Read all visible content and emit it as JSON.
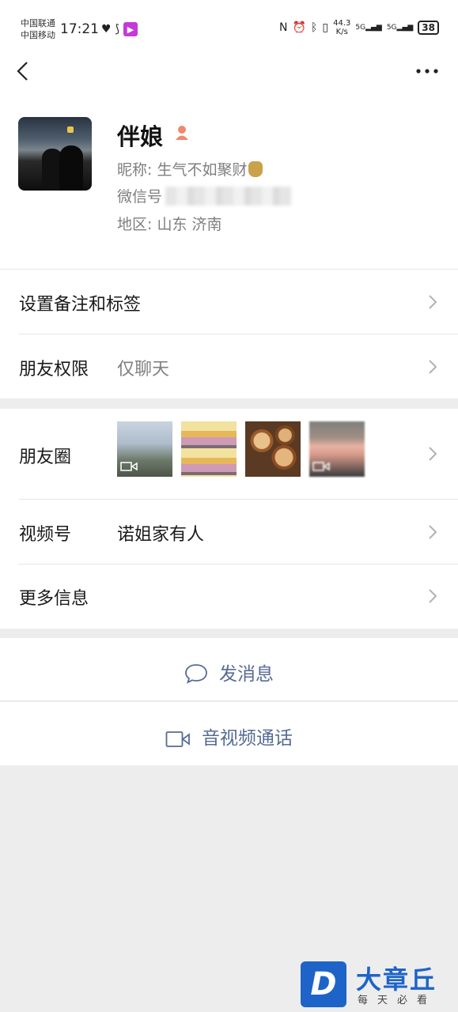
{
  "status_bar": {
    "carrier1": "中国联通",
    "carrier2": "中国移动",
    "time": "17:21",
    "net_speed": "44.3",
    "net_unit": "K/s",
    "signal1": "5G",
    "signal2": "5G",
    "battery": "38"
  },
  "profile": {
    "name": "伴娘",
    "nickname_label": "昵称: ",
    "nickname": "生气不如聚财",
    "wechat_id_label": "微信号",
    "region_label": "地区: ",
    "region": "山东  济南"
  },
  "rows": {
    "remark_label": "设置备注和标签",
    "permission_label": "朋友权限",
    "permission_value": "仅聊天",
    "moments_label": "朋友圈",
    "channels_label": "视频号",
    "channels_value": "诺姐家有人",
    "more_label": "更多信息"
  },
  "actions": {
    "message": "发消息",
    "call": "音视频通话"
  },
  "watermark": {
    "logo_letter": "D",
    "title": "大章丘",
    "subtitle": "每天必看"
  },
  "colors": {
    "link": "#576b95",
    "background": "#ededed",
    "watermark": "#1e64c8"
  }
}
